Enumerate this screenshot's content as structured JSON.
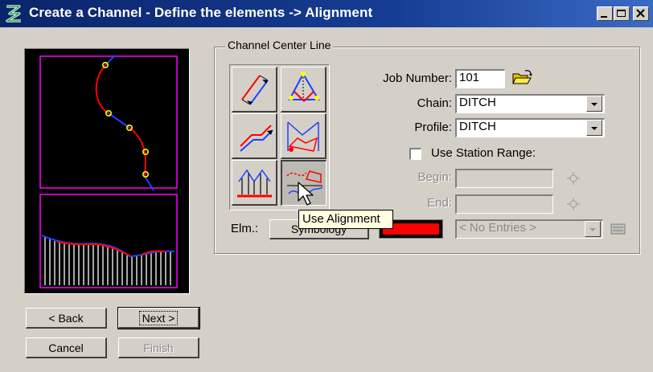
{
  "window": {
    "title": "Create a Channel - Define the elements -> Alignment",
    "buttons": {
      "minimize": "minimize",
      "maximize": "maximize",
      "close": "close"
    }
  },
  "wizard": {
    "back_label": "< Back",
    "next_label": "Next >",
    "cancel_label": "Cancel",
    "finish_label": "Finish"
  },
  "group": {
    "legend": "Channel Center Line",
    "job_number_label": "Job Number:",
    "job_number_value": "101",
    "chain_label": "Chain:",
    "chain_value": "DITCH",
    "profile_label": "Profile:",
    "profile_value": "DITCH",
    "use_station_range_label": "Use Station Range:",
    "begin_label": "Begin:",
    "begin_value": "",
    "end_label": "End:",
    "end_value": "",
    "elm_label": "Elm.:",
    "symbology_label": "Symbology",
    "entries_value": "< No Entries >"
  },
  "tooltip": {
    "text": "Use Alignment"
  },
  "colors": {
    "title_bar": "#0a246a",
    "dialog_bg": "#d4d0c8",
    "preview_magenta": "#ff00ff",
    "alignment_red": "#ff0000",
    "alignment_blue": "#2040ff",
    "point_yellow": "#ffff00",
    "tooltip_bg": "#ffffe1"
  },
  "icons": {
    "app": "geopak-logo-icon",
    "folder": "open-folder-icon",
    "target": "crosshair-target-icon",
    "settings": "settings-grid-icon"
  }
}
